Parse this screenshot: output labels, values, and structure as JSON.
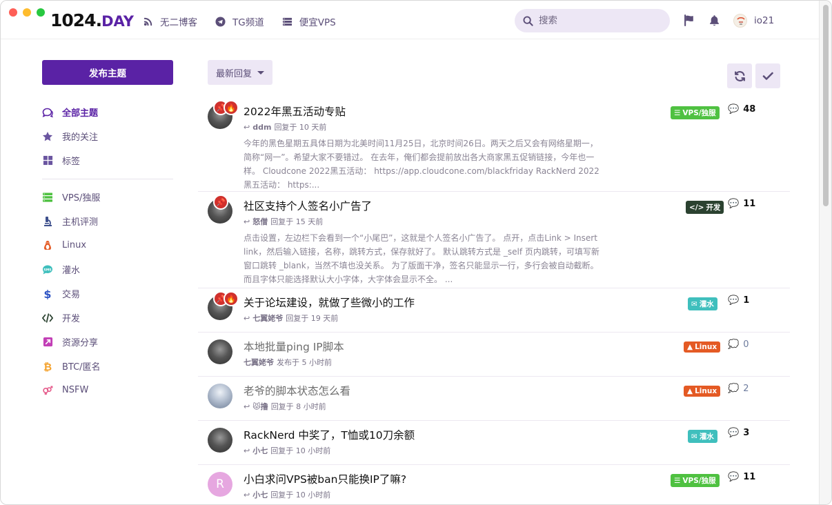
{
  "header": {
    "logo_main": "1024.",
    "logo_day": "DAY",
    "nav": [
      {
        "label": "无二博客",
        "icon": "blog-icon"
      },
      {
        "label": "TG频道",
        "icon": "telegram-icon"
      },
      {
        "label": "便宜VPS",
        "icon": "server-icon"
      }
    ],
    "search_placeholder": "搜索",
    "username": "io21"
  },
  "sidebar": {
    "publish_label": "发布主题",
    "primary": [
      {
        "label": "全部主题",
        "icon": "comments-icon",
        "color": "#5a22a5",
        "active": true
      },
      {
        "label": "我的关注",
        "icon": "star-icon",
        "color": "#6a55a0"
      },
      {
        "label": "标签",
        "icon": "grid-icon",
        "color": "#6a55a0"
      }
    ],
    "tags": [
      {
        "label": "VPS/独服",
        "icon": "server-icon",
        "color": "#4fc141"
      },
      {
        "label": "主机评测",
        "icon": "microscope-icon",
        "color": "#3d4f8c"
      },
      {
        "label": "Linux",
        "icon": "linux-icon",
        "color": "#e45a24"
      },
      {
        "label": "灌水",
        "icon": "chat-icon",
        "color": "#3fbfbd"
      },
      {
        "label": "交易",
        "icon": "dollar-icon",
        "color": "#2f55c4"
      },
      {
        "label": "开发",
        "icon": "code-icon",
        "color": "#2b4230"
      },
      {
        "label": "资源分享",
        "icon": "share-icon",
        "color": "#c23fb6"
      },
      {
        "label": "BTC/匿名",
        "icon": "bitcoin-icon",
        "color": "#f4a12b"
      },
      {
        "label": "NSFW",
        "icon": "gender-icon",
        "color": "#e55a8a"
      }
    ]
  },
  "toolbar": {
    "sort_label": "最新回复"
  },
  "topics": [
    {
      "title": "2022年黑五活动专贴",
      "user": "ddm",
      "action": "回复于 10 天前",
      "reply_icon": true,
      "tag": "VPS/独服",
      "tag_class": "tag-vps",
      "tag_icon": "server-icon",
      "replies": "48",
      "unread": false,
      "badges": [
        "pin",
        "fire"
      ],
      "avatar": "gray",
      "excerpt": "今年的黑色星期五具体日期为北美时间11月25日，北京时间26日。两天之后又会有网络星期一，简称“网一”。希望大家不要错过。 在去年，俺们都会提前放出各大商家黑五促销链接，今年也一样。 Cloudcone 2022黑五活动： https://app.cloudcone.com/blackfriday RackNerd 2022黑五活动： https:..."
    },
    {
      "title": "社区支持个人签名小广告了",
      "user": "怒僧",
      "action": "回复于 15 天前",
      "reply_icon": true,
      "tag": "开发",
      "tag_class": "tag-dev",
      "tag_icon": "code-icon",
      "replies": "11",
      "unread": false,
      "badges": [
        "pin"
      ],
      "avatar": "gray",
      "excerpt": "点击设置，左边栏下会看到一个“小尾巴”，这就是个人签名小广告了。 点开，点击Link > Insert link，然后输入链接，名称，跳转方式，保存就好了。 默认跳转方式是 _self 页内跳转，可填写新窗口跳转 _blank，当然不填也没关系。 为了版面干净，签名只能显示一行，多行会被自动截断。而且字体只能选择默认大小字体，大字体会显示不全。 ..."
    },
    {
      "title": "关于论坛建设，就做了些微小的工作",
      "user": "七翼姥爷",
      "action": "回复于 19 天前",
      "reply_icon": true,
      "tag": "灌水",
      "tag_class": "tag-water",
      "tag_icon": "chat-icon",
      "replies": "1",
      "unread": false,
      "badges": [
        "pin",
        "fire"
      ],
      "avatar": "gray",
      "excerpt": ""
    },
    {
      "title": "本地批量ping IP脚本",
      "user": "七翼姥爷",
      "action": "发布于 5 小时前",
      "reply_icon": false,
      "tag": "Linux",
      "tag_class": "tag-linux",
      "tag_icon": "linux-icon",
      "replies": "0",
      "unread": true,
      "badges": [],
      "avatar": "gray",
      "excerpt": ""
    },
    {
      "title": "老爷的脚本状态怎么看",
      "user": "😾撸",
      "action": "回复于 8 小时前",
      "reply_icon": true,
      "tag": "Linux",
      "tag_class": "tag-linux",
      "tag_icon": "linux-icon",
      "replies": "2",
      "unread": true,
      "badges": [],
      "avatar": "skel",
      "excerpt": ""
    },
    {
      "title": "RackNerd 中奖了，T恤或10刀余额",
      "user": "小七",
      "action": "回复于 10 小时前",
      "reply_icon": true,
      "tag": "灌水",
      "tag_class": "tag-water",
      "tag_icon": "chat-icon",
      "replies": "3",
      "unread": false,
      "badges": [],
      "avatar": "gray",
      "excerpt": ""
    },
    {
      "title": "小白求问VPS被ban只能换IP了嘛?",
      "user": "小七",
      "action": "回复于 10 小时前",
      "reply_icon": true,
      "tag": "VPS/独服",
      "tag_class": "tag-vps",
      "tag_icon": "server-icon",
      "replies": "11",
      "unread": false,
      "badges": [],
      "avatar": "letter",
      "avatar_letter": "R",
      "excerpt": ""
    }
  ]
}
